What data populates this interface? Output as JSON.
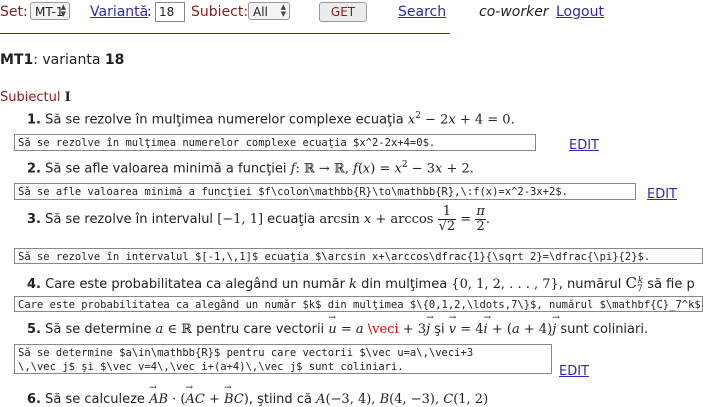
{
  "toolbar": {
    "set_label": "Set:",
    "set_value": "MT-1",
    "varianta_label": "Variantă",
    "varianta_suffix": ":",
    "varianta_value": "18",
    "subiect_label": "Subiect:",
    "subiect_value": "All",
    "get_button": "GET",
    "search_link": "Search",
    "user_role": "co-worker",
    "logout_link": "Logout"
  },
  "heading": {
    "set_code": "MT1",
    "text": ": varianta ",
    "number": "18"
  },
  "section": {
    "label": "Subiectul ",
    "numeral": "I"
  },
  "edit_label": "EDIT",
  "problems": [
    {
      "num": "1.",
      "text_a": "Să se rezolve în mulţimea numerelor complexe ecuaţia ",
      "text_b": ".",
      "source": "Să se rezolve în mulţimea numerelor complexe ecuaţia $x^2-2x+4=0$."
    },
    {
      "num": "2.",
      "text_a": "Să se afle valoarea minimă a funcţiei ",
      "text_b": ".",
      "source": "Să se afle valoarea minimă a funcţiei $f\\colon\\mathbb{R}\\to\\mathbb{R},\\:f(x)=x^2-3x+2$."
    },
    {
      "num": "3.",
      "text_a": "Să se rezolve în intervalul ",
      "text_b": " ecuaţia ",
      "text_c": ".",
      "source": "Să se rezolve în intervalul $[-1,\\,1]$ ecuaţia $\\arcsin x+\\arccos\\dfrac{1}{\\sqrt 2}=\\dfrac{\\pi}{2}$."
    },
    {
      "num": "4.",
      "text_a": "Care este probabilitatea ca alegând un număr ",
      "text_b": " din mulţimea ",
      "text_c": ", numărul ",
      "text_d": " să fie p",
      "source": "Care este probabilitatea ca alegând un număr $k$ din mulţimea $\\{0,1,2,\\ldots,7\\}$, numărul $\\mathbf{C}_7^k$"
    },
    {
      "num": "5.",
      "text_a": "Să se determine ",
      "text_b": " pentru care vectorii ",
      "text_c": " şi ",
      "text_d": " sunt coliniari.",
      "source_line1": "Să se determine $a\\in\\mathbb{R}$ pentru care vectorii $\\vec u=a\\,\\veci+3",
      "source_line2": "\\,\\vec j$ şi $\\vec v=4\\,\\vec i+(a+4)\\,\\vec j$ sunt coliniari."
    },
    {
      "num": "6.",
      "text_a": "Să se calculeze ",
      "text_b": ", ştiind că "
    }
  ]
}
